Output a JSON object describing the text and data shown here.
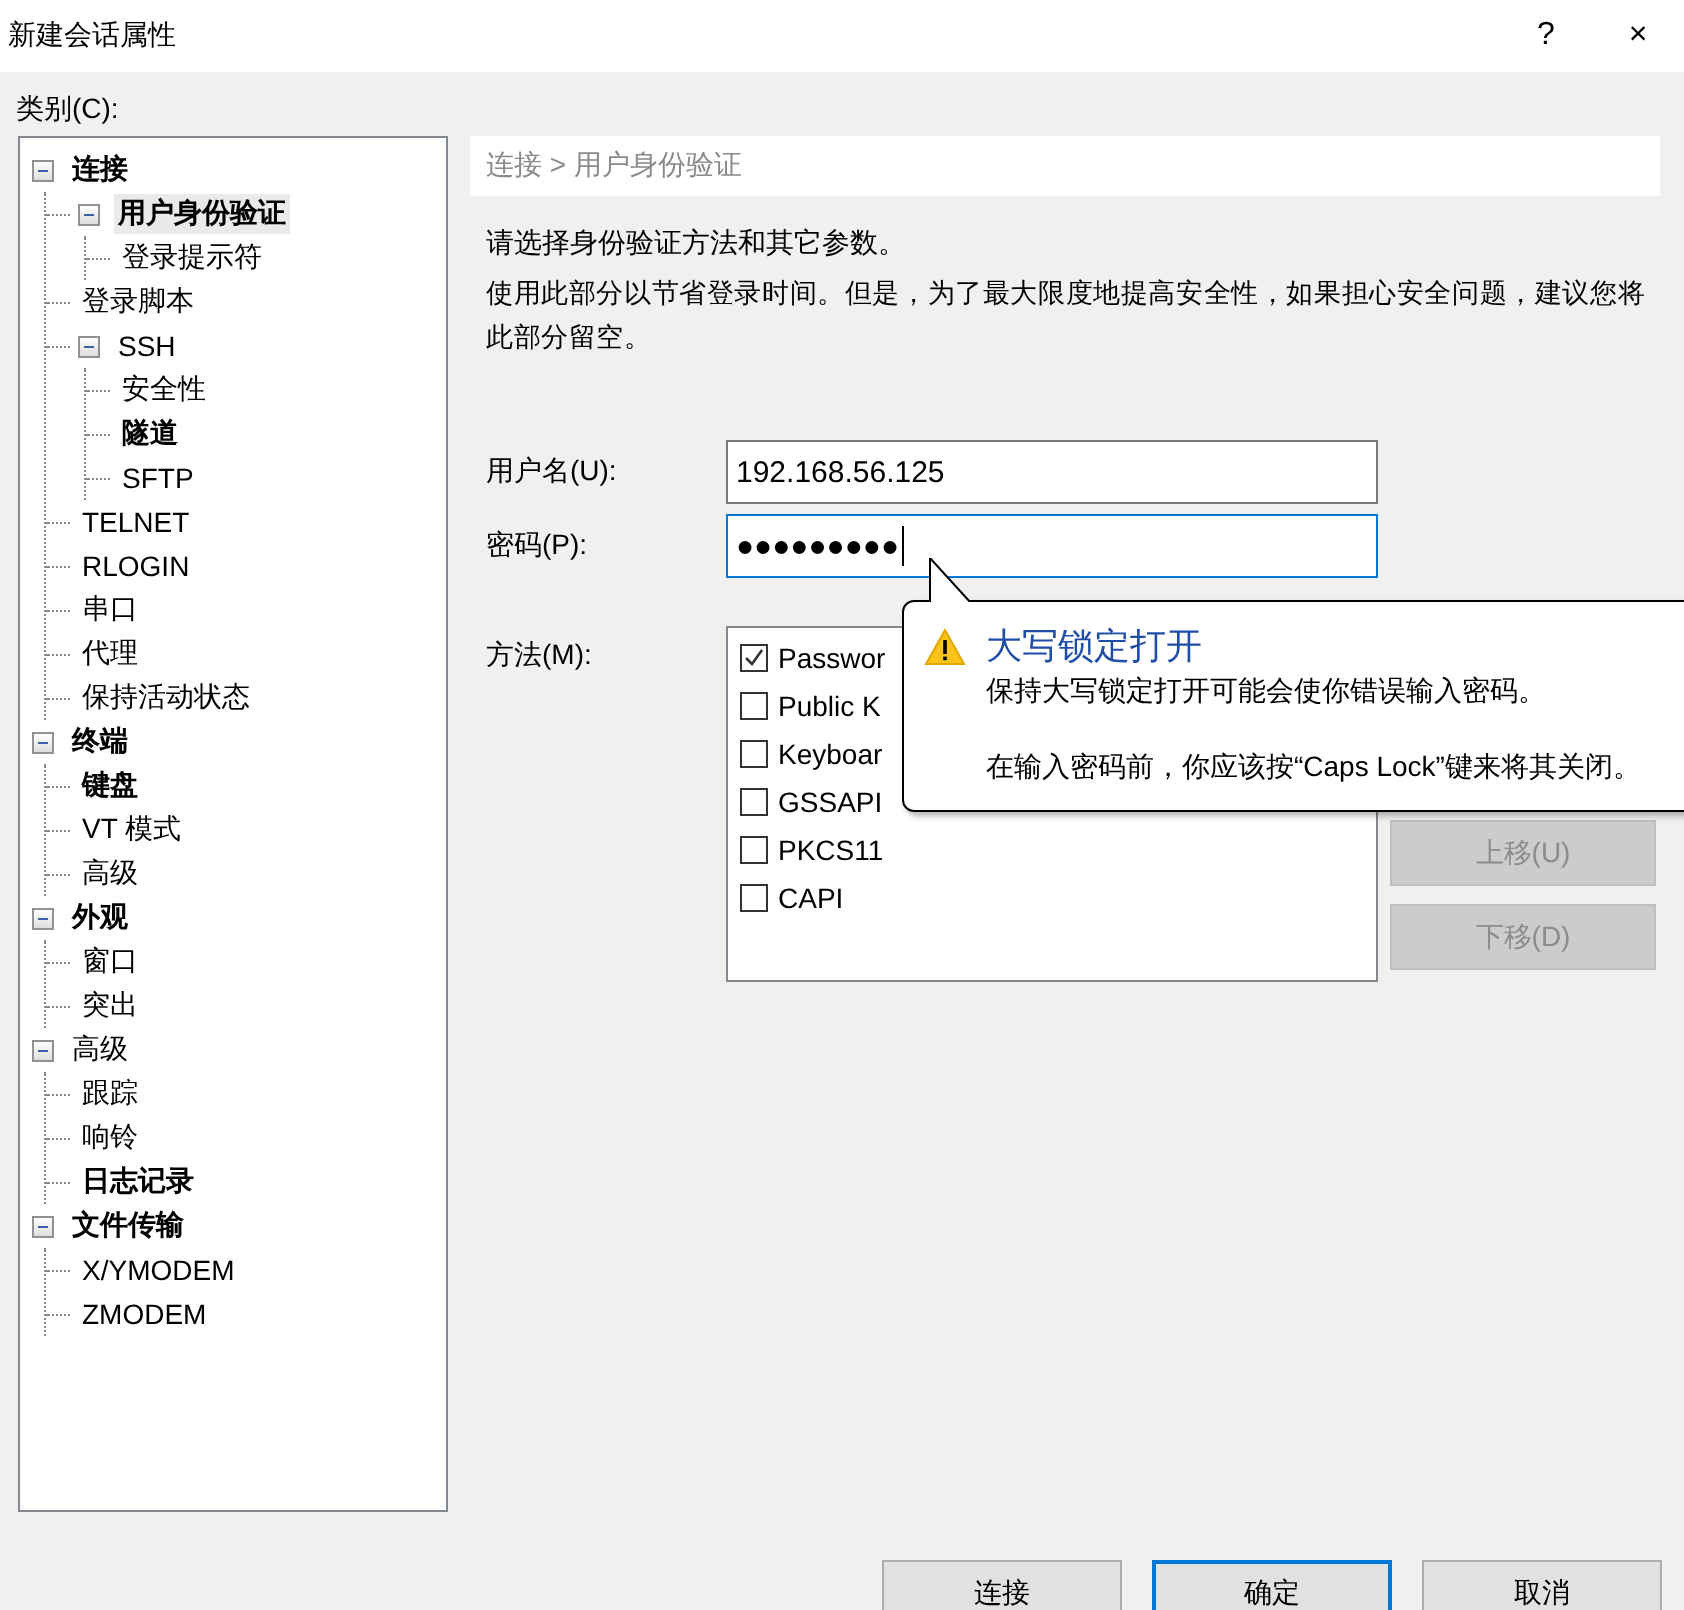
{
  "window": {
    "title": "新建会话属性",
    "help": "?",
    "close": "×"
  },
  "category_label": "类别(C):",
  "tree": [
    {
      "label": "连接",
      "bold": true,
      "selected": false,
      "expanded": true,
      "children": [
        {
          "label": "用户身份验证",
          "bold": true,
          "selected": true,
          "expanded": true,
          "children": [
            {
              "label": "登录提示符",
              "bold": false,
              "selected": false
            }
          ]
        },
        {
          "label": "登录脚本",
          "bold": false,
          "selected": false
        },
        {
          "label": "SSH",
          "bold": false,
          "selected": false,
          "expanded": true,
          "children": [
            {
              "label": "安全性",
              "bold": false,
              "selected": false
            },
            {
              "label": "隧道",
              "bold": true,
              "selected": false
            },
            {
              "label": "SFTP",
              "bold": false,
              "selected": false
            }
          ]
        },
        {
          "label": "TELNET",
          "bold": false,
          "selected": false
        },
        {
          "label": "RLOGIN",
          "bold": false,
          "selected": false
        },
        {
          "label": "串口",
          "bold": false,
          "selected": false
        },
        {
          "label": "代理",
          "bold": false,
          "selected": false
        },
        {
          "label": "保持活动状态",
          "bold": false,
          "selected": false
        }
      ]
    },
    {
      "label": "终端",
      "bold": true,
      "selected": false,
      "expanded": true,
      "children": [
        {
          "label": "键盘",
          "bold": true,
          "selected": false
        },
        {
          "label": "VT 模式",
          "bold": false,
          "selected": false
        },
        {
          "label": "高级",
          "bold": false,
          "selected": false
        }
      ]
    },
    {
      "label": "外观",
      "bold": true,
      "selected": false,
      "expanded": true,
      "children": [
        {
          "label": "窗口",
          "bold": false,
          "selected": false
        },
        {
          "label": "突出",
          "bold": false,
          "selected": false
        }
      ]
    },
    {
      "label": "高级",
      "bold": false,
      "selected": false,
      "expanded": true,
      "children": [
        {
          "label": "跟踪",
          "bold": false,
          "selected": false
        },
        {
          "label": "响铃",
          "bold": false,
          "selected": false
        },
        {
          "label": "日志记录",
          "bold": true,
          "selected": false
        }
      ]
    },
    {
      "label": "文件传输",
      "bold": true,
      "selected": false,
      "expanded": true,
      "children": [
        {
          "label": "X/YMODEM",
          "bold": false,
          "selected": false
        },
        {
          "label": "ZMODEM",
          "bold": false,
          "selected": false
        }
      ]
    }
  ],
  "breadcrumb": "连接 > 用户身份验证",
  "intro": "请选择身份验证方法和其它参数。",
  "description": "使用此部分以节省登录时间。但是，为了最大限度地提高安全性，如果担心安全问题，建议您将此部分留空。",
  "username": {
    "label": "用户名(U):",
    "value": "192.168.56.125"
  },
  "password": {
    "label": "密码(P):",
    "value": "●●●●●●●●●",
    "focused": true
  },
  "method": {
    "label": "方法(M):",
    "items": [
      {
        "label": "Passwor",
        "checked": true
      },
      {
        "label": "Public K",
        "checked": false
      },
      {
        "label": "Keyboar",
        "checked": false
      },
      {
        "label": "GSSAPI",
        "checked": false
      },
      {
        "label": "PKCS11",
        "checked": false
      },
      {
        "label": "CAPI",
        "checked": false
      }
    ]
  },
  "side_buttons": [
    {
      "label": "上移(U)",
      "disabled": true
    },
    {
      "label": "下移(D)",
      "disabled": true
    }
  ],
  "tooltip": {
    "title": "大写锁定打开",
    "lines": [
      "保持大写锁定打开可能会使你错误输入密码。",
      "在输入密码前，你应该按“Caps Lock”键来将其关闭。"
    ]
  },
  "buttons": [
    {
      "label": "连接",
      "focused": false
    },
    {
      "label": "确定",
      "focused": true
    },
    {
      "label": "取消",
      "focused": false
    }
  ]
}
